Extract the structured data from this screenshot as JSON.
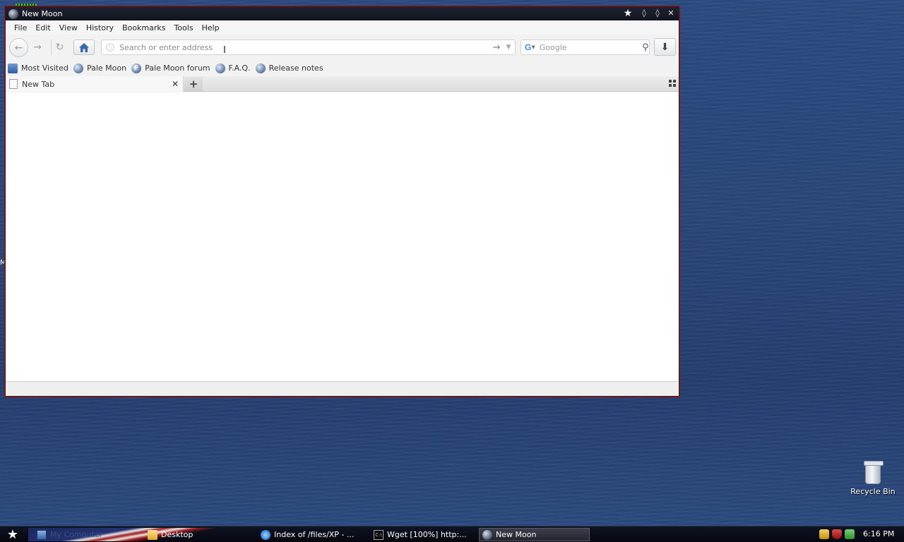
{
  "desktop": {
    "stub_text": "M",
    "recycle_bin_label": "Recycle Bin"
  },
  "window": {
    "title": "New Moon",
    "menu": [
      "File",
      "Edit",
      "View",
      "History",
      "Bookmarks",
      "Tools",
      "Help"
    ],
    "urlbar": {
      "value": "",
      "placeholder": "Search or enter address"
    },
    "searchbar": {
      "engine": "G",
      "value": "",
      "placeholder": "Google"
    },
    "bookmarks": [
      {
        "label": "Most Visited",
        "icon": "most-visited-icon"
      },
      {
        "label": "Pale Moon",
        "icon": "globe-icon"
      },
      {
        "label": "Pale Moon forum",
        "icon": "forum-icon",
        "glyph": "F"
      },
      {
        "label": "F.A.Q.",
        "icon": "globe-icon"
      },
      {
        "label": "Release notes",
        "icon": "globe-icon"
      }
    ],
    "tabs": [
      {
        "label": "New Tab",
        "close": "✕"
      }
    ],
    "new_tab_symbol": "+"
  },
  "taskbar": {
    "items": [
      {
        "label": "My Computer",
        "icon": "computer-icon"
      },
      {
        "label": "Desktop",
        "icon": "folder-icon"
      },
      {
        "label": "Index of /files/XP - ...",
        "icon": "ie-icon"
      },
      {
        "label": "Wget [100%] http:...",
        "icon": "cmd-icon",
        "glyph": "C:\\"
      },
      {
        "label": "New Moon",
        "icon": "moon-icon",
        "active": true
      }
    ],
    "tray_icons": [
      "keys-icon",
      "shield-icon",
      "network-icon"
    ],
    "clock": "6:16 PM"
  },
  "colors": {
    "desktop": "#284679",
    "titlebar": "#12151f",
    "window_border": "#8a1a1a",
    "taskbar": "#05070e"
  }
}
